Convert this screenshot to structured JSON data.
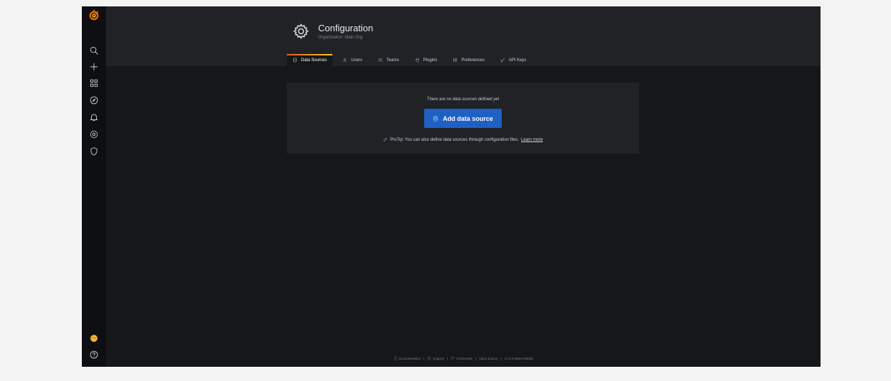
{
  "colors": {
    "background": "#161719",
    "panel": "#202226",
    "sidebar": "#0e0f12",
    "accent": "#1f60c4",
    "tab_gradient_start": "#f05a28",
    "tab_gradient_end": "#fbca0a"
  },
  "sidebar": {
    "items": [
      {
        "icon": "grafana-logo-icon"
      },
      {
        "icon": "search-icon"
      },
      {
        "icon": "plus-icon"
      },
      {
        "icon": "dashboards-icon"
      },
      {
        "icon": "explore-compass-icon"
      },
      {
        "icon": "alerting-bell-icon"
      },
      {
        "icon": "configuration-gear-icon"
      },
      {
        "icon": "server-admin-shield-icon"
      }
    ],
    "bottom": [
      {
        "icon": "user-avatar-icon"
      },
      {
        "icon": "help-icon"
      }
    ]
  },
  "header": {
    "title": "Configuration",
    "subtitle": "Organization: Main Org.",
    "icon": "gear-icon"
  },
  "tabs": [
    {
      "label": "Data Sources",
      "icon": "database-icon",
      "active": true
    },
    {
      "label": "Users",
      "icon": "user-icon",
      "active": false
    },
    {
      "label": "Teams",
      "icon": "users-icon",
      "active": false
    },
    {
      "label": "Plugins",
      "icon": "plug-icon",
      "active": false
    },
    {
      "label": "Preferences",
      "icon": "sliders-icon",
      "active": false
    },
    {
      "label": "API Keys",
      "icon": "key-icon",
      "active": false
    }
  ],
  "empty_state": {
    "message": "There are no data sources defined yet",
    "button_label": "Add data source",
    "protip": "ProTip: You can also define data sources through configuration files.",
    "learn_more": "Learn more"
  },
  "footer": {
    "documentation": "Documentation",
    "support": "Support",
    "community": "Community",
    "open_source": "Open Source",
    "version": "v7.0.3 (00ee734baf)",
    "separator": "|"
  }
}
